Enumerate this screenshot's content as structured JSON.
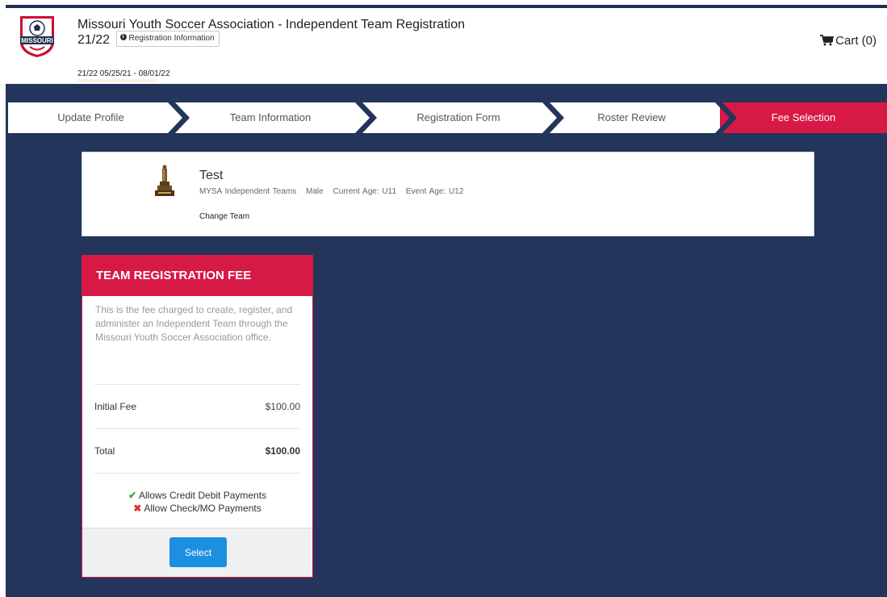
{
  "header": {
    "title": "Missouri Youth Soccer Association - Independent Team Registration 21/22",
    "info_button": "Registration Information",
    "dates": "21/22 05/25/21 - 08/01/22",
    "logo_text": "MISSOURI",
    "cart_label": "Cart (0)"
  },
  "steps": [
    {
      "label": "Update Profile",
      "active": false
    },
    {
      "label": "Team Information",
      "active": false
    },
    {
      "label": "Registration Form",
      "active": false
    },
    {
      "label": "Roster Review",
      "active": false
    },
    {
      "label": "Fee Selection",
      "active": true
    }
  ],
  "team": {
    "name": "Test",
    "meta": [
      "MYSA Independent Teams",
      "Male",
      "Current Age: U11",
      "Event Age: U12"
    ],
    "change_label": "Change Team"
  },
  "fee": {
    "title": "TEAM REGISTRATION FEE",
    "description": "This is the fee charged to create, register, and administer an Independent Team through the Missouri Youth Soccer Association office.",
    "initial_label": "Initial Fee",
    "initial_amount": "$100.00",
    "total_label": "Total",
    "total_amount": "$100.00",
    "payment_credit": "Allows Credit Debit Payments",
    "payment_check": "Allow Check/MO Payments",
    "select_label": "Select"
  },
  "colors": {
    "navy": "#23355a",
    "accent": "#d71a45",
    "button": "#1c8fe0"
  }
}
